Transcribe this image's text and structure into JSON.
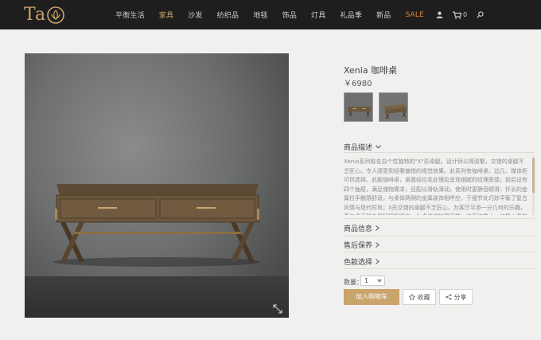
{
  "brand": {
    "logo_text": "Ta",
    "accent_color": "#c9a46b",
    "sale_color": "#d9883a"
  },
  "nav": {
    "items": [
      {
        "label": "平衡生活"
      },
      {
        "label": "家具"
      },
      {
        "label": "沙发"
      },
      {
        "label": "纺织品"
      },
      {
        "label": "地毯"
      },
      {
        "label": "饰品"
      },
      {
        "label": "灯具"
      },
      {
        "label": "礼品季"
      },
      {
        "label": "新品"
      },
      {
        "label": "SALE"
      }
    ],
    "icons": [
      "user-icon",
      "cart-icon",
      "search-icon"
    ],
    "cart_count": "0"
  },
  "product": {
    "title": "Xenia 咖啡桌",
    "price": "￥6980",
    "thumbnails": [
      "coffee-table-front",
      "coffee-table-angle"
    ]
  },
  "sections": {
    "description_label": "商品描述",
    "description_text": "Xenia系列取名自个性独特的\"X\"形桌腿。设计师以简驳繁，交错的桌腿不乏匠心，令人感受到轻奢偏悦的视觉效果。此系列有咖啡桌、边几、媒体柜可供选择。此款咖啡桌，桌面经拉毛处理后呈现细腻的纹理质感；前后设有四个抽屉，满足储物需求，且配以滑轨滑动，使用时更静音顺滑；钎长的金属拉手触感舒适，与桌体两侧的金属装饰相呼应，于细节处巧妙平衡了复古风情与现代时尚；X形交错的桌腿不乏匠心，为客厅平添一分几何的乐趣，更与桌面的金属钉扣相呼应，为桌体增加稳固性，选用红橡木，红橡木素有坚固耐用之称。",
    "info_label": "商品信息",
    "service_label": "售后保养",
    "color_label": "色款选择"
  },
  "purchase": {
    "qty_label": "数量：",
    "qty_value": "1",
    "add_to_cart": "加入购物车",
    "favorite": "收藏",
    "share": "分享"
  }
}
